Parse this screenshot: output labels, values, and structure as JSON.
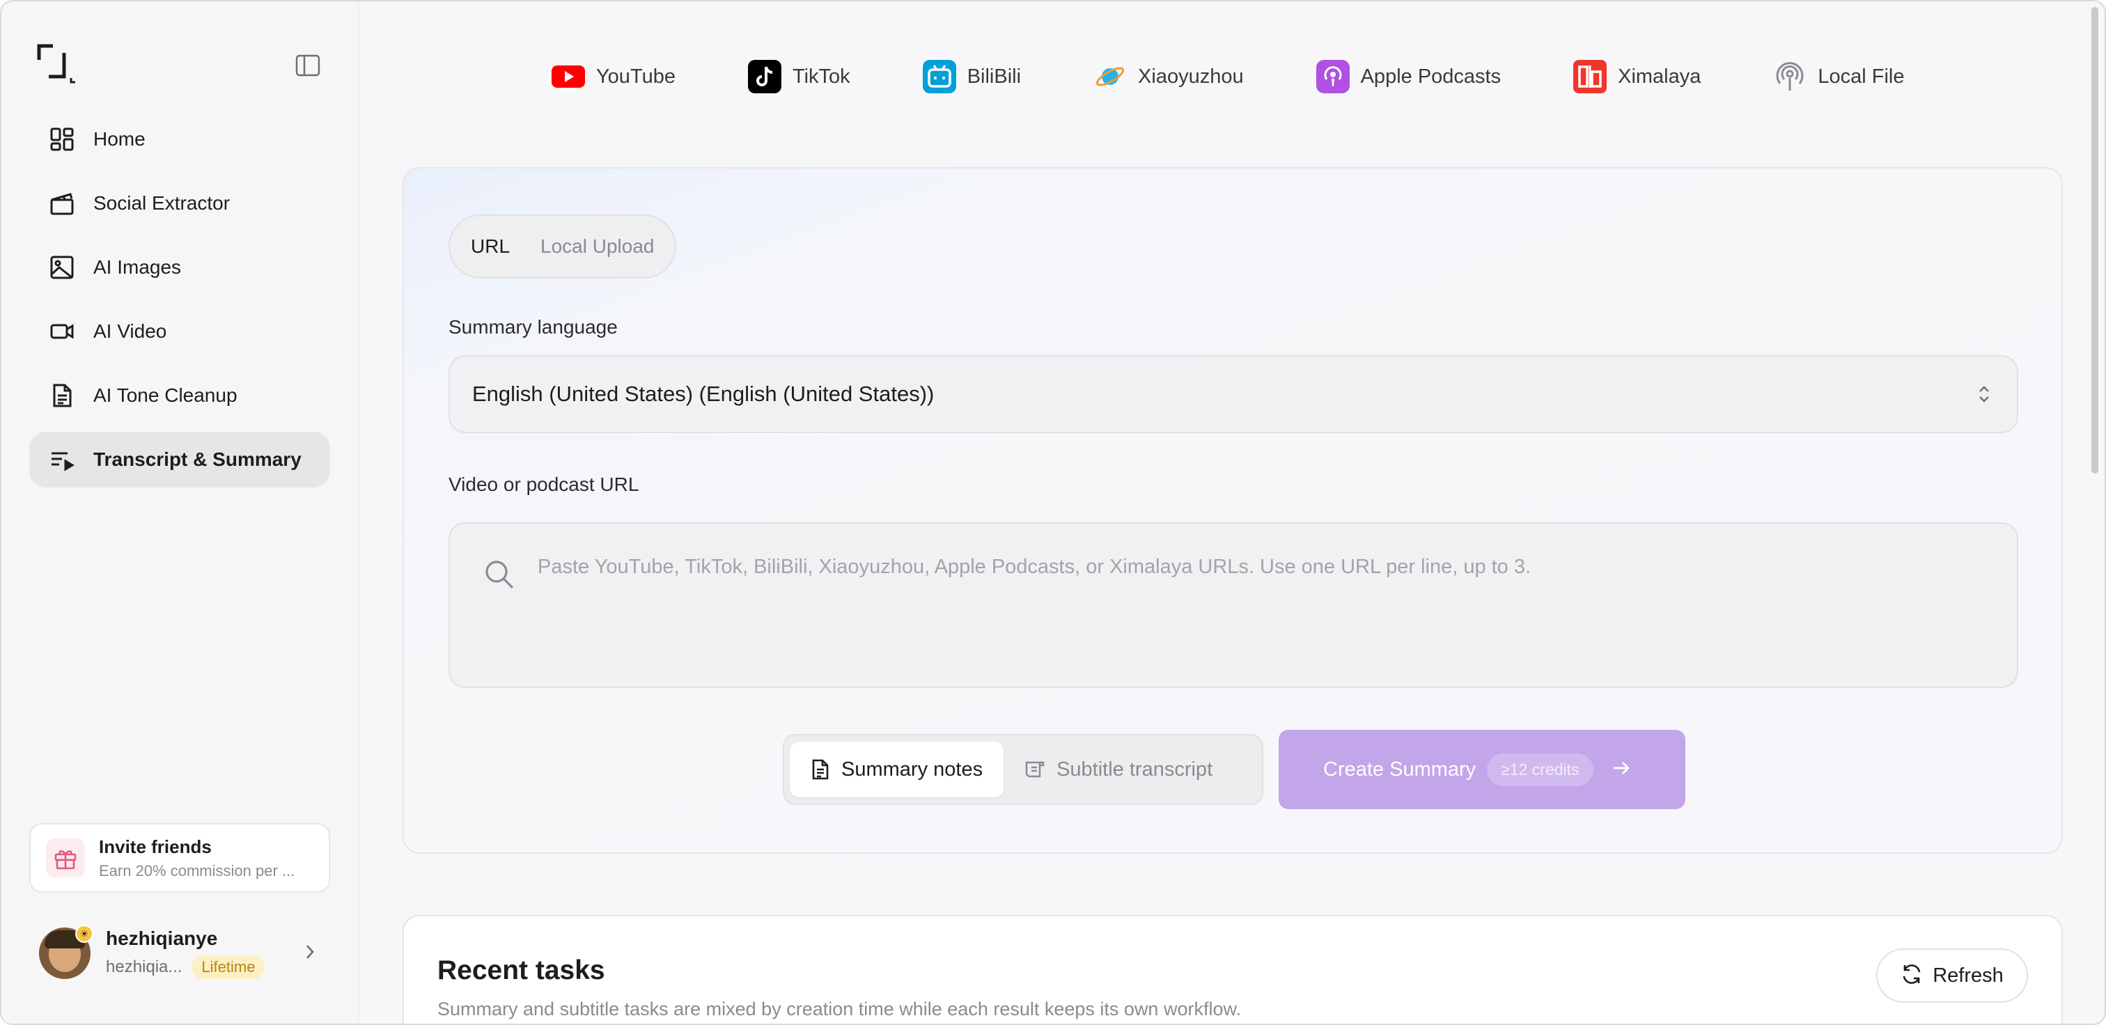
{
  "sidebar": {
    "nav": [
      {
        "label": "Home",
        "icon": "grid-icon"
      },
      {
        "label": "Social Extractor",
        "icon": "clapperboard-icon"
      },
      {
        "label": "AI Images",
        "icon": "image-icon"
      },
      {
        "label": "AI Video",
        "icon": "video-camera-icon"
      },
      {
        "label": "AI Tone Cleanup",
        "icon": "document-icon"
      },
      {
        "label": "Transcript & Summary",
        "icon": "list-play-icon",
        "active": true
      }
    ],
    "invite": {
      "title": "Invite friends",
      "subtitle": "Earn 20% commission per ..."
    },
    "user": {
      "name": "hezhiqianye",
      "handle": "hezhiqia...",
      "plan": "Lifetime"
    }
  },
  "platforms": [
    {
      "label": "YouTube",
      "color": "#ff0000"
    },
    {
      "label": "TikTok",
      "color": "#000000"
    },
    {
      "label": "BiliBili",
      "color": "#00a1d6"
    },
    {
      "label": "Xiaoyuzhou",
      "color": "#25b4e8"
    },
    {
      "label": "Apple Podcasts",
      "color": "#b150e2"
    },
    {
      "label": "Ximalaya",
      "color": "#f0352b"
    },
    {
      "label": "Local File",
      "color": "#8a8a8f"
    }
  ],
  "source_tabs": {
    "url": "URL",
    "upload": "Local Upload",
    "selected": "URL"
  },
  "language": {
    "label": "Summary language",
    "value": "English (United States) (English (United States))"
  },
  "url_input": {
    "label": "Video or podcast URL",
    "value": "",
    "placeholder": "Paste YouTube, TikTok, BiliBili, Xiaoyuzhou, Apple Podcasts, or Ximalaya URLs. Use one URL per line, up to 3."
  },
  "mode": {
    "summary": "Summary notes",
    "subtitle": "Subtitle transcript",
    "selected": "Summary notes"
  },
  "create": {
    "label": "Create Summary",
    "credits": "≥12 credits",
    "color": "#c3a6ea"
  },
  "recent": {
    "title": "Recent tasks",
    "subtitle": "Summary and subtitle tasks are mixed by creation time while each result keeps its own workflow.",
    "refresh": "Refresh"
  }
}
